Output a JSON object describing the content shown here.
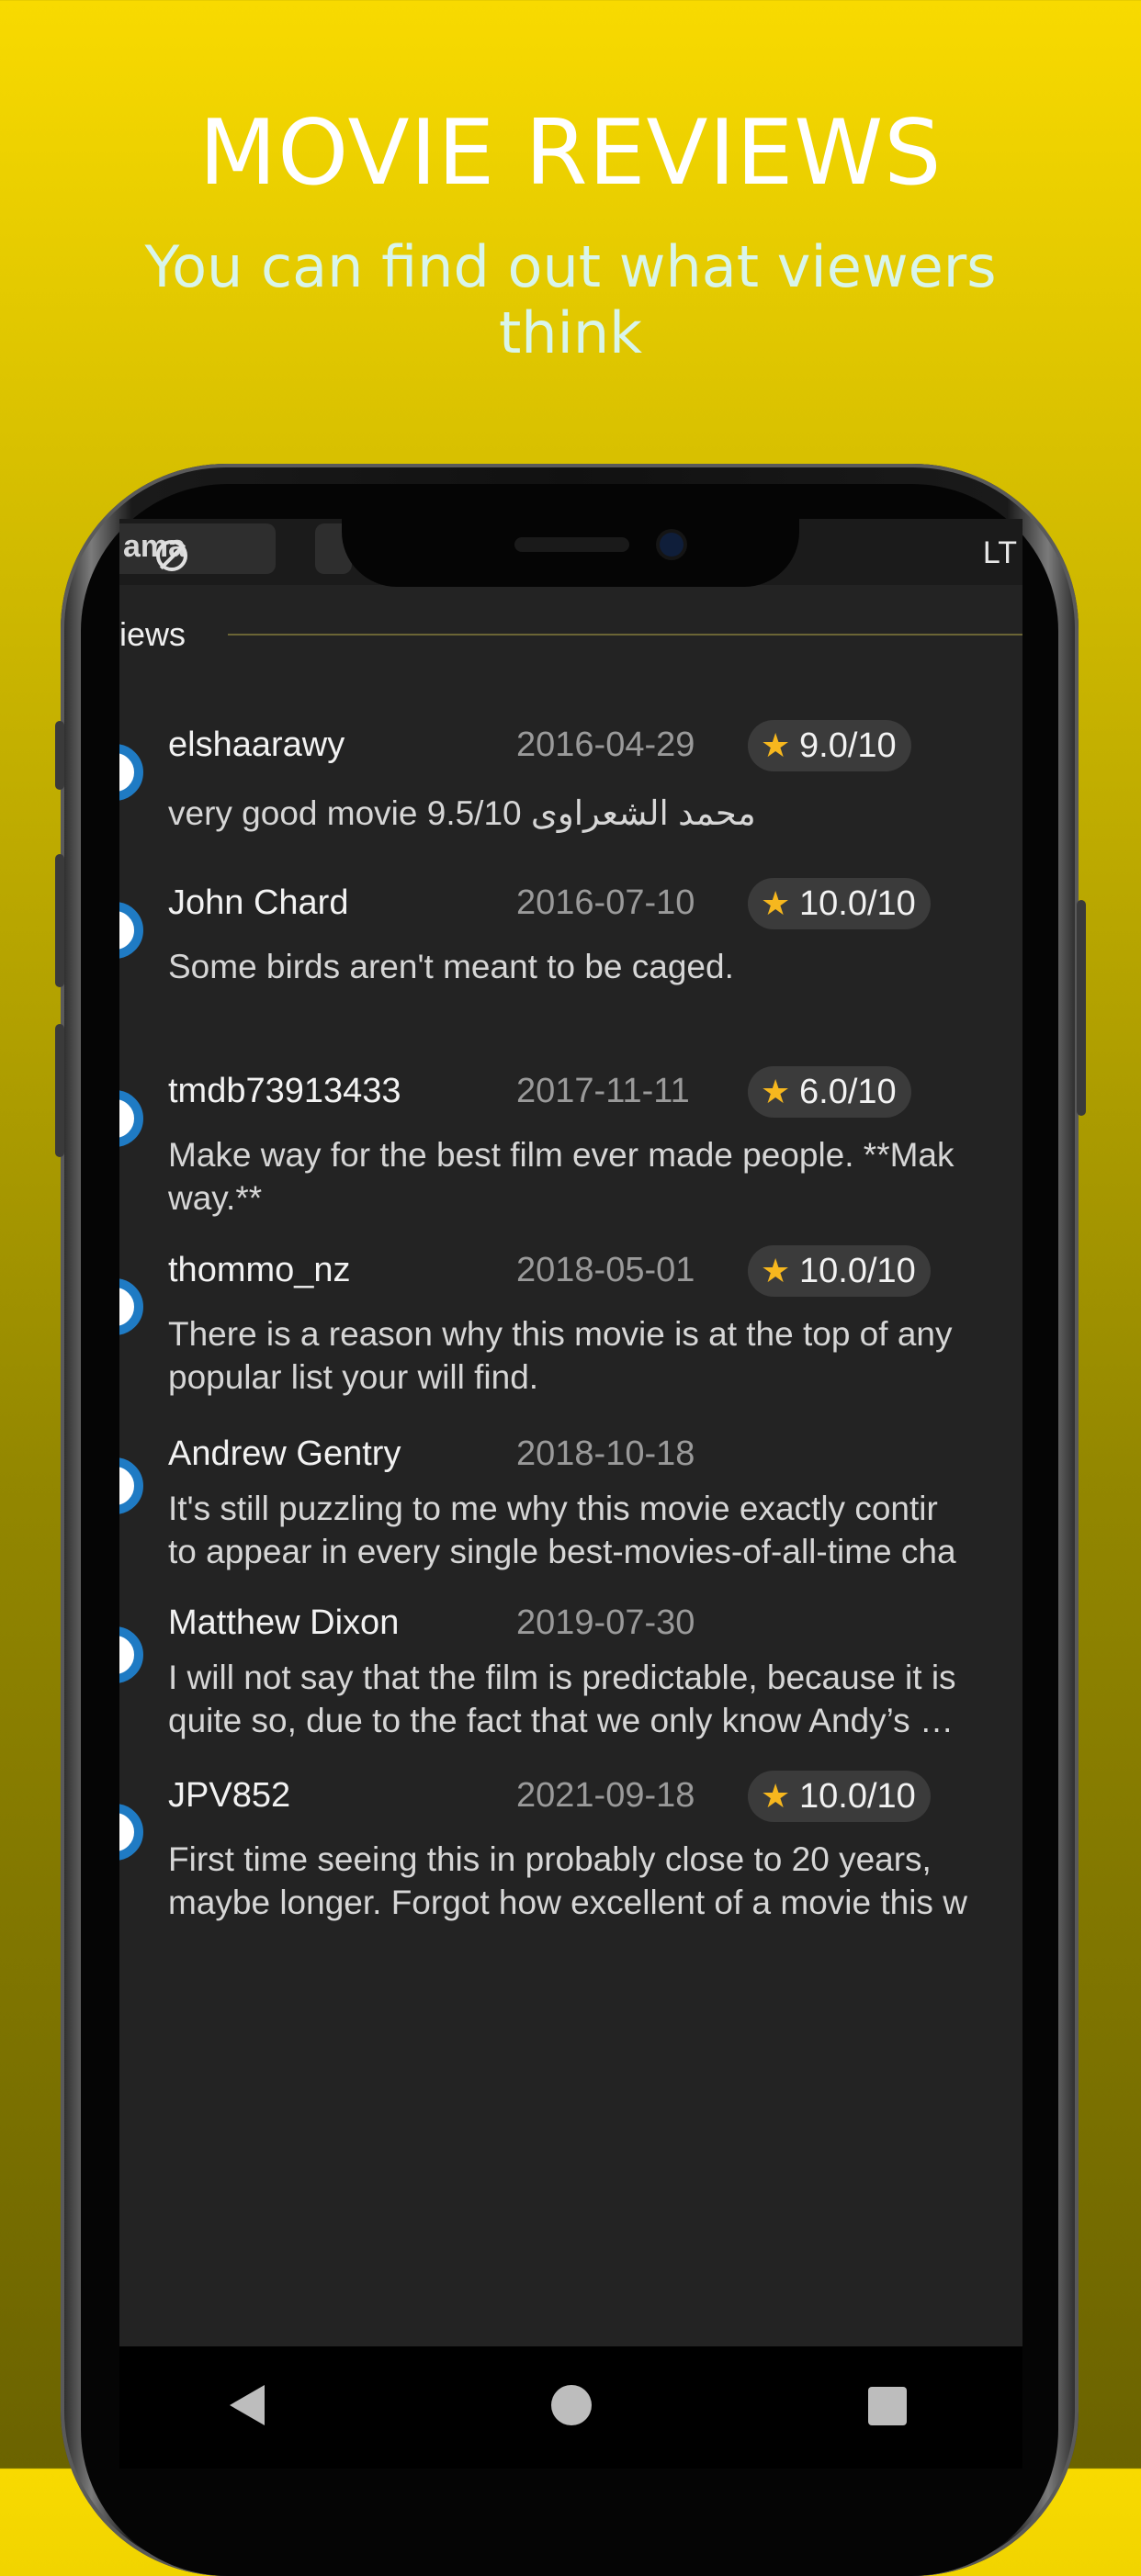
{
  "hero": {
    "title": "MOVIE REVIEWS",
    "subtitle_line1": "You can find out what viewers",
    "subtitle_line2": "think"
  },
  "topbar": {
    "tab_label": "ama",
    "right_text": "LT"
  },
  "section": {
    "title": "iews"
  },
  "reviews": [
    {
      "author": "elshaarawy",
      "date": "2016-04-29",
      "rating": "9.0/10",
      "text": "very good movie 9.5/10 محمد الشعراوى"
    },
    {
      "author": "John Chard",
      "date": "2016-07-10",
      "rating": "10.0/10",
      "text": "Some birds aren't meant to be caged."
    },
    {
      "author": "tmdb73913433",
      "date": "2017-11-11",
      "rating": "6.0/10",
      "text": "Make way for the best film ever made people. **Mak\nway.**"
    },
    {
      "author": "thommo_nz",
      "date": "2018-05-01",
      "rating": "10.0/10",
      "text": "There is a reason why this movie is at the top of any\npopular list your will find."
    },
    {
      "author": "Andrew Gentry",
      "date": "2018-10-18",
      "rating": "",
      "text": "It's still puzzling to me why this movie exactly contir\nto appear in every single best-movies-of-all-time cha"
    },
    {
      "author": "Matthew Dixon",
      "date": "2019-07-30",
      "rating": "",
      "text": "I will not say that the film is predictable, because it is\nquite so, due to the fact that we only know Andy’s …"
    },
    {
      "author": "JPV852",
      "date": "2021-09-18",
      "rating": "10.0/10",
      "text": "First time seeing this in probably close to 20 years,\nmaybe longer. Forgot how excellent of a movie this w"
    }
  ],
  "colors": {
    "accent_star": "#f6b71e",
    "avatar_ring": "#1f7bc4",
    "background_top": "#f8da00",
    "background_bottom": "#6b6300"
  }
}
